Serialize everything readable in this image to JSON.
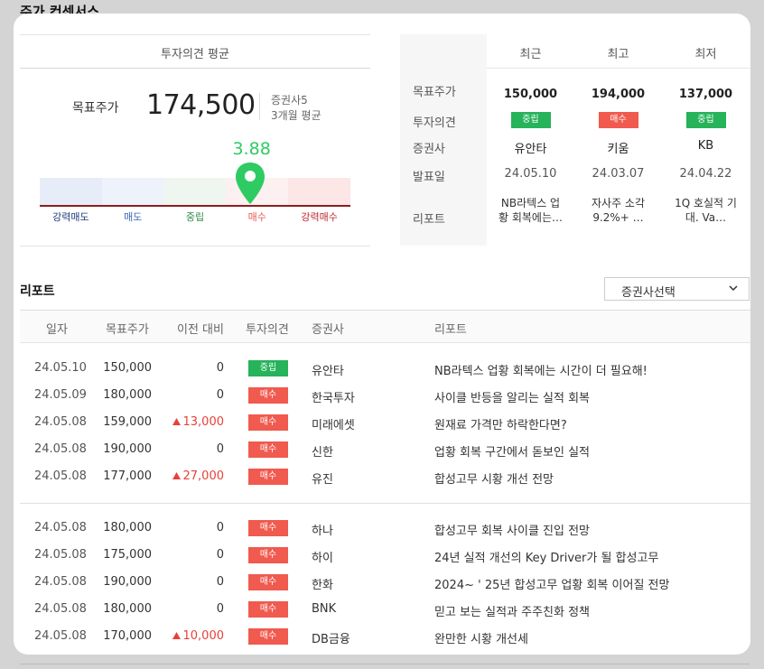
{
  "page_title": "주가 컨센서스",
  "consensus": {
    "title": "투자의견 평균",
    "target_label": "목표주가",
    "target_price": "174,500",
    "broker_count": "증권사5",
    "period": "3개월 평균",
    "score": "3.88",
    "score_value": 3.88,
    "gauge": {
      "labels": [
        "강력매도",
        "매도",
        "중립",
        "매수",
        "강력매수"
      ],
      "segment_colors": [
        "#e6edf8",
        "#edf2fb",
        "#eef6ef",
        "#fdf0f0",
        "#fce6e6"
      ],
      "label_colors": [
        "#1e3d7a",
        "#3a67b8",
        "#2e8b4a",
        "#e25b50",
        "#c0272d"
      ],
      "pin_color": "#2ecb63"
    }
  },
  "recent_summary": {
    "columns": [
      "최근",
      "최고",
      "최저"
    ],
    "row_labels": [
      "목표주가",
      "투자의견",
      "증권사",
      "발표일",
      "리포트"
    ],
    "items": [
      {
        "price": "150,000",
        "opinion": "중립",
        "opinion_type": "hold",
        "broker": "유안타",
        "date": "24.05.10",
        "report_line1": "NB라텍스 업",
        "report_line2": "황 회복에는…"
      },
      {
        "price": "194,000",
        "opinion": "매수",
        "opinion_type": "buy",
        "broker": "키움",
        "date": "24.03.07",
        "report_line1": "자사주 소각",
        "report_line2": "9.2%+ …"
      },
      {
        "price": "137,000",
        "opinion": "중립",
        "opinion_type": "hold",
        "broker": "KB",
        "date": "24.04.22",
        "report_line1": "1Q 호실적 기",
        "report_line2": "대. Va…"
      }
    ]
  },
  "reports": {
    "title": "리포트",
    "select_label": "증권사선택",
    "headers": [
      "일자",
      "목표주가",
      "이전 대비",
      "투자의견",
      "증권사",
      "리포트"
    ],
    "colors": {
      "buy": "#f05a4f",
      "hold": "#26b35a",
      "up": "#e8413a"
    },
    "rows": [
      {
        "date": "24.05.10",
        "price": "150,000",
        "diff": "0",
        "diff_up": false,
        "opinion": "중립",
        "opinion_type": "hold",
        "broker": "유안타",
        "title": "NB라텍스 업황 회복에는 시간이 더 필요해!"
      },
      {
        "date": "24.05.09",
        "price": "180,000",
        "diff": "0",
        "diff_up": false,
        "opinion": "매수",
        "opinion_type": "buy",
        "broker": "한국투자",
        "title": "사이클 반등을 알리는 실적 회복"
      },
      {
        "date": "24.05.08",
        "price": "159,000",
        "diff": "13,000",
        "diff_up": true,
        "opinion": "매수",
        "opinion_type": "buy",
        "broker": "미래에셋",
        "title": "원재료 가격만 하락한다면?"
      },
      {
        "date": "24.05.08",
        "price": "190,000",
        "diff": "0",
        "diff_up": false,
        "opinion": "매수",
        "opinion_type": "buy",
        "broker": "신한",
        "title": "업황 회복 구간에서 돋보인 실적"
      },
      {
        "date": "24.05.08",
        "price": "177,000",
        "diff": "27,000",
        "diff_up": true,
        "opinion": "매수",
        "opinion_type": "buy",
        "broker": "유진",
        "title": "합성고무 시황 개선 전망"
      },
      {
        "date": "24.05.08",
        "price": "180,000",
        "diff": "0",
        "diff_up": false,
        "opinion": "매수",
        "opinion_type": "buy",
        "broker": "하나",
        "title": "합성고무 회복 사이클 진입 전망"
      },
      {
        "date": "24.05.08",
        "price": "175,000",
        "diff": "0",
        "diff_up": false,
        "opinion": "매수",
        "opinion_type": "buy",
        "broker": "하이",
        "title": "24년 실적 개선의 Key Driver가 될 합성고무"
      },
      {
        "date": "24.05.08",
        "price": "190,000",
        "diff": "0",
        "diff_up": false,
        "opinion": "매수",
        "opinion_type": "buy",
        "broker": "한화",
        "title": "2024~ ' 25년 합성고무 업황 회복 이어질 전망"
      },
      {
        "date": "24.05.08",
        "price": "180,000",
        "diff": "0",
        "diff_up": false,
        "opinion": "매수",
        "opinion_type": "buy",
        "broker": "BNK",
        "title": "믿고 보는 실적과 주주친화 정책"
      },
      {
        "date": "24.05.08",
        "price": "170,000",
        "diff": "10,000",
        "diff_up": true,
        "opinion": "매수",
        "opinion_type": "buy",
        "broker": "DB금융",
        "title": "완만한 시황 개선세"
      }
    ]
  }
}
